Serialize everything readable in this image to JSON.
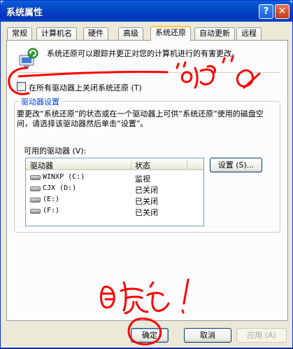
{
  "window": {
    "title": "系统属性"
  },
  "titlebar": {
    "help_glyph": "?",
    "close_glyph": "✕"
  },
  "tabs": [
    {
      "label": "常规"
    },
    {
      "label": "计算机名"
    },
    {
      "label": "硬件"
    },
    {
      "label": "高级"
    },
    {
      "label": "系统还原",
      "active": true
    },
    {
      "label": "自动更新"
    },
    {
      "label": "远程"
    }
  ],
  "intro_text": "系统还原可以跟踪并更正对您的计算机进行的有害更改。",
  "disable_checkbox": {
    "label": "在所有驱动器上关闭系统还原 (T)",
    "checked": false
  },
  "drive_group": {
    "title": "驱动器设置",
    "description": "要更改“系统还原”的状态或在一个驱动器上可供“系统还原”使用的磁盘空间，请选择该驱动器然后单击“设置”。",
    "available_label": "可用的驱动器 (V):"
  },
  "drive_table": {
    "columns": [
      "驱动器",
      "状态"
    ],
    "rows": [
      {
        "name": "WINXP (C:)",
        "status": "监视"
      },
      {
        "name": "CJX (D:)",
        "status": "已关闭"
      },
      {
        "name": "(E:)",
        "status": "已关闭"
      },
      {
        "name": "(F:)",
        "status": "已关闭"
      }
    ]
  },
  "buttons": {
    "settings": "设置 (S)...",
    "ok": "确定",
    "cancel": "取消",
    "apply": "应用 (A)"
  },
  "colors": {
    "title_bar": "#0a4fd0",
    "group_title": "#0046d5",
    "annotation": "#ff0000",
    "active_tab_accent": "#ffc83c"
  }
}
